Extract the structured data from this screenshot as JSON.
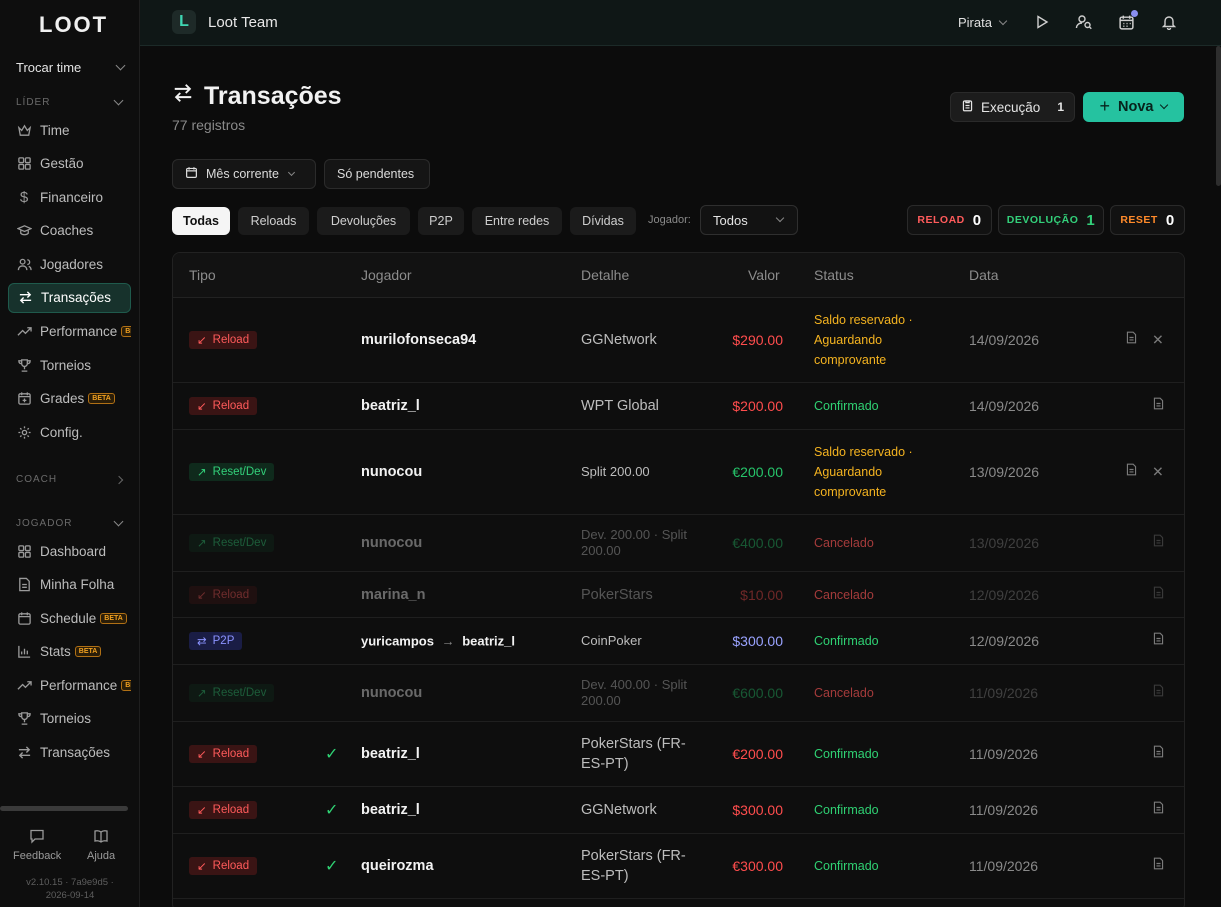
{
  "sidebar": {
    "logo": "LOOT",
    "team_switch": "Trocar time",
    "sections": {
      "lider": "LÍDER",
      "coach": "COACH",
      "jogador": "JOGADOR"
    },
    "lider_items": [
      {
        "label": "Time",
        "icon": "crown-icon",
        "beta": false,
        "active": false
      },
      {
        "label": "Gestão",
        "icon": "grid-icon",
        "beta": false,
        "active": false
      },
      {
        "label": "Financeiro",
        "icon": "dollar-icon",
        "beta": false,
        "active": false
      },
      {
        "label": "Coaches",
        "icon": "graduation-cap-icon",
        "beta": false,
        "active": false
      },
      {
        "label": "Jogadores",
        "icon": "users-icon",
        "beta": false,
        "active": false
      },
      {
        "label": "Transações",
        "icon": "arrows-swap-icon",
        "beta": false,
        "active": true
      },
      {
        "label": "Performance",
        "icon": "trend-icon",
        "beta": true,
        "active": false
      },
      {
        "label": "Torneios",
        "icon": "trophy-icon",
        "beta": false,
        "active": false
      },
      {
        "label": "Grades",
        "icon": "calendar-plus-icon",
        "beta": true,
        "active": false
      },
      {
        "label": "Config.",
        "icon": "gear-icon",
        "beta": false,
        "active": false
      }
    ],
    "jogador_items": [
      {
        "label": "Dashboard",
        "icon": "grid-icon",
        "beta": false
      },
      {
        "label": "Minha Folha",
        "icon": "document-icon",
        "beta": false
      },
      {
        "label": "Schedule",
        "icon": "calendar-icon",
        "beta": true
      },
      {
        "label": "Stats",
        "icon": "bar-chart-icon",
        "beta": true
      },
      {
        "label": "Performance",
        "icon": "trend-icon",
        "beta": true
      },
      {
        "label": "Torneios",
        "icon": "trophy-icon",
        "beta": false
      },
      {
        "label": "Transações",
        "icon": "arrows-swap-icon",
        "beta": false
      }
    ],
    "beta_label": "BETA",
    "feedback": "Feedback",
    "help": "Ajuda",
    "version_line1": "v2.10.15 · 7a9e9d5 ·",
    "version_line2": "2026-09-14"
  },
  "topbar": {
    "team_initial": "L",
    "team_name": "Loot Team",
    "user": "Pirata"
  },
  "page": {
    "title": "Transações",
    "subtitle": "77 registros",
    "exec_label": "Execução",
    "exec_count": "1",
    "new_label": "Nova",
    "filters": {
      "period": "Mês corrente",
      "pending": "Só pendentes"
    },
    "tabs": [
      "Todas",
      "Reloads",
      "Devoluções",
      "P2P",
      "Entre redes",
      "Dívidas"
    ],
    "player_label": "Jogador:",
    "player_value": "Todos",
    "stats": [
      {
        "label": "RELOAD",
        "value": "0",
        "color": "#ff5b5b"
      },
      {
        "label": "DEVOLUÇÃO",
        "value": "1",
        "color": "#33d07a"
      },
      {
        "label": "RESET",
        "value": "0",
        "color": "#ff8a2a"
      }
    ]
  },
  "table": {
    "headers": {
      "tipo": "Tipo",
      "jogador": "Jogador",
      "detalhe": "Detalhe",
      "valor": "Valor",
      "status": "Status",
      "data": "Data"
    },
    "rows": [
      {
        "type": "Reload",
        "player": "murilofonseca94",
        "detail": "GGNetwork",
        "value": "$290.00",
        "status_l1": "Saldo reservado ·",
        "status_l2": "Aguardando",
        "status_l3": "comprovante",
        "date": "14/09/2026"
      },
      {
        "type": "Reload",
        "player": "beatriz_l",
        "detail": "WPT Global",
        "value": "$200.00",
        "status": "Confirmado",
        "date": "14/09/2026"
      },
      {
        "type": "Reset/Dev",
        "player": "nunocou",
        "detail": "Split 200.00",
        "value": "€200.00",
        "status_l1": "Saldo reservado ·",
        "status_l2": "Aguardando",
        "status_l3": "comprovante",
        "date": "13/09/2026"
      },
      {
        "type": "Reset/Dev",
        "player": "nunocou",
        "detail_l1": "Dev. 200.00 · Split",
        "detail_l2": "200.00",
        "value": "€400.00",
        "status": "Cancelado",
        "date": "13/09/2026"
      },
      {
        "type": "Reload",
        "player": "marina_n",
        "detail": "PokerStars",
        "value": "$10.00",
        "status": "Cancelado",
        "date": "12/09/2026"
      },
      {
        "type": "P2P",
        "player_from": "yuricampos",
        "arrow": "→",
        "player_to": "beatriz_l",
        "detail": "CoinPoker",
        "value": "$300.00",
        "status": "Confirmado",
        "date": "12/09/2026"
      },
      {
        "type": "Reset/Dev",
        "player": "nunocou",
        "detail_l1": "Dev. 400.00 · Split",
        "detail_l2": "200.00",
        "value": "€600.00",
        "status": "Cancelado",
        "date": "11/09/2026"
      },
      {
        "type": "Reload",
        "player": "beatriz_l",
        "detail_l1": "PokerStars (FR-",
        "detail_l2": "ES-PT)",
        "value": "€200.00",
        "status": "Confirmado",
        "date": "11/09/2026"
      },
      {
        "type": "Reload",
        "player": "beatriz_l",
        "detail": "GGNetwork",
        "value": "$300.00",
        "status": "Confirmado",
        "date": "11/09/2026"
      },
      {
        "type": "Reload",
        "player": "queirozma",
        "detail_l1": "PokerStars (FR-",
        "detail_l2": "ES-PT)",
        "value": "€300.00",
        "status": "Confirmado",
        "date": "11/09/2026"
      }
    ]
  }
}
